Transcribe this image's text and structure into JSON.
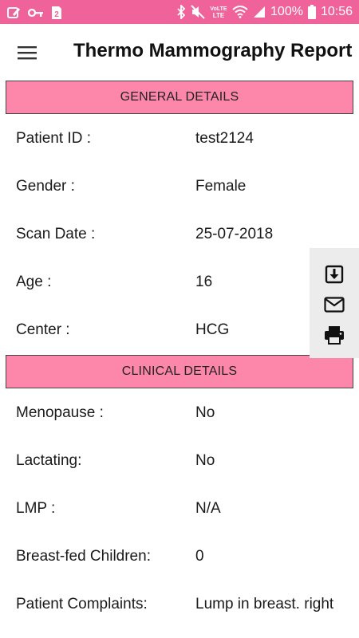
{
  "status_bar": {
    "battery": "100%",
    "time": "10:56",
    "sim_badge": "2",
    "network": "LTE",
    "volte": "VoLTE",
    "icons": [
      "pen-square-icon",
      "key-icon",
      "sim-icon",
      "bluetooth-icon",
      "mute-icon",
      "volte-icon",
      "wifi-icon",
      "signal-icon",
      "battery-icon"
    ],
    "color": "#f0629a"
  },
  "app_bar": {
    "title": "Thermo Mammography Report",
    "menu_icon": "hamburger-menu-icon"
  },
  "general": {
    "header": "GENERAL DETAILS",
    "rows": [
      {
        "label": "Patient ID :",
        "value": "test2124"
      },
      {
        "label": "Gender :",
        "value": "Female"
      },
      {
        "label": "Scan Date :",
        "value": "25-07-2018"
      },
      {
        "label": "Age :",
        "value": "16"
      },
      {
        "label": "Center :",
        "value": "HCG"
      }
    ]
  },
  "clinical": {
    "header": "CLINICAL DETAILS",
    "rows": [
      {
        "label": "Menopause :",
        "value": "No"
      },
      {
        "label": "Lactating:",
        "value": "No"
      },
      {
        "label": "LMP :",
        "value": "N/A"
      },
      {
        "label": "Breast-fed Children:",
        "value": "0"
      },
      {
        "label": "Patient Complaints:",
        "value": "Lump in breast. right"
      }
    ]
  },
  "actions": {
    "icons": [
      "download-icon",
      "email-icon",
      "print-icon"
    ]
  },
  "colors": {
    "section_header": "#fc87ab",
    "action_panel": "#ececec"
  }
}
